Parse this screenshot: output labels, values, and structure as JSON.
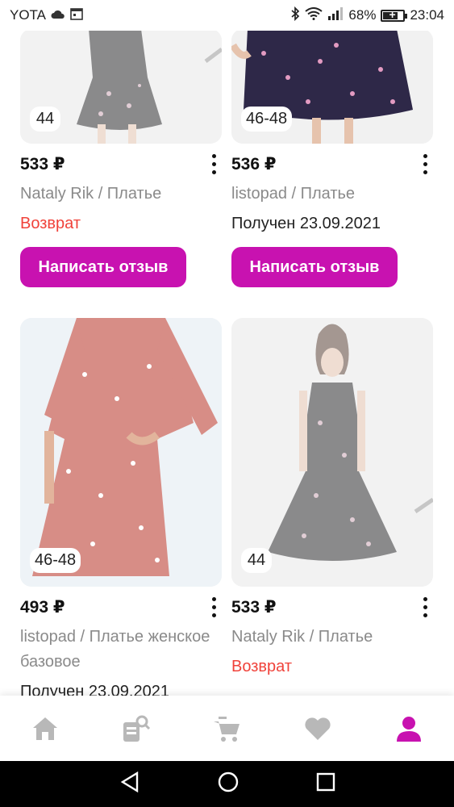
{
  "status_bar": {
    "carrier": "YOTA",
    "battery_percent": "68%",
    "battery_level": 0.68,
    "time": "23:04"
  },
  "products": [
    {
      "size": "44",
      "price": "533 ₽",
      "brand_line": "Nataly Rik / Платье",
      "status": "Возврат",
      "status_type": "returned",
      "button": "Написать отзыв",
      "icon": "dark-floral-dress-photo"
    },
    {
      "size": "46-48",
      "price": "536 ₽",
      "brand_line": "listopad / Платье",
      "status": "Получен 23.09.2021",
      "status_type": "received",
      "button": "Написать отзыв",
      "icon": "navy-floral-dress-photo"
    },
    {
      "size": "46-48",
      "price": "493 ₽",
      "brand_line": "listopad / Платье женское базовое",
      "status": "Получен 23.09.2021",
      "status_type": "received",
      "icon": "pink-floral-dress-photo"
    },
    {
      "size": "44",
      "price": "533 ₽",
      "brand_line": "Nataly Rik / Платье",
      "status": "Возврат",
      "status_type": "returned",
      "icon": "dark-floral-dress-photo"
    }
  ],
  "bottom_nav": {
    "items": [
      "home-icon",
      "catalog-search-icon",
      "cart-icon",
      "favorites-heart-icon",
      "profile-icon"
    ],
    "active": "profile-icon"
  },
  "colors": {
    "accent": "#c812b0",
    "returned": "#f0423a",
    "muted": "#8a8a8a",
    "nav_inactive": "#b8b8b8"
  }
}
